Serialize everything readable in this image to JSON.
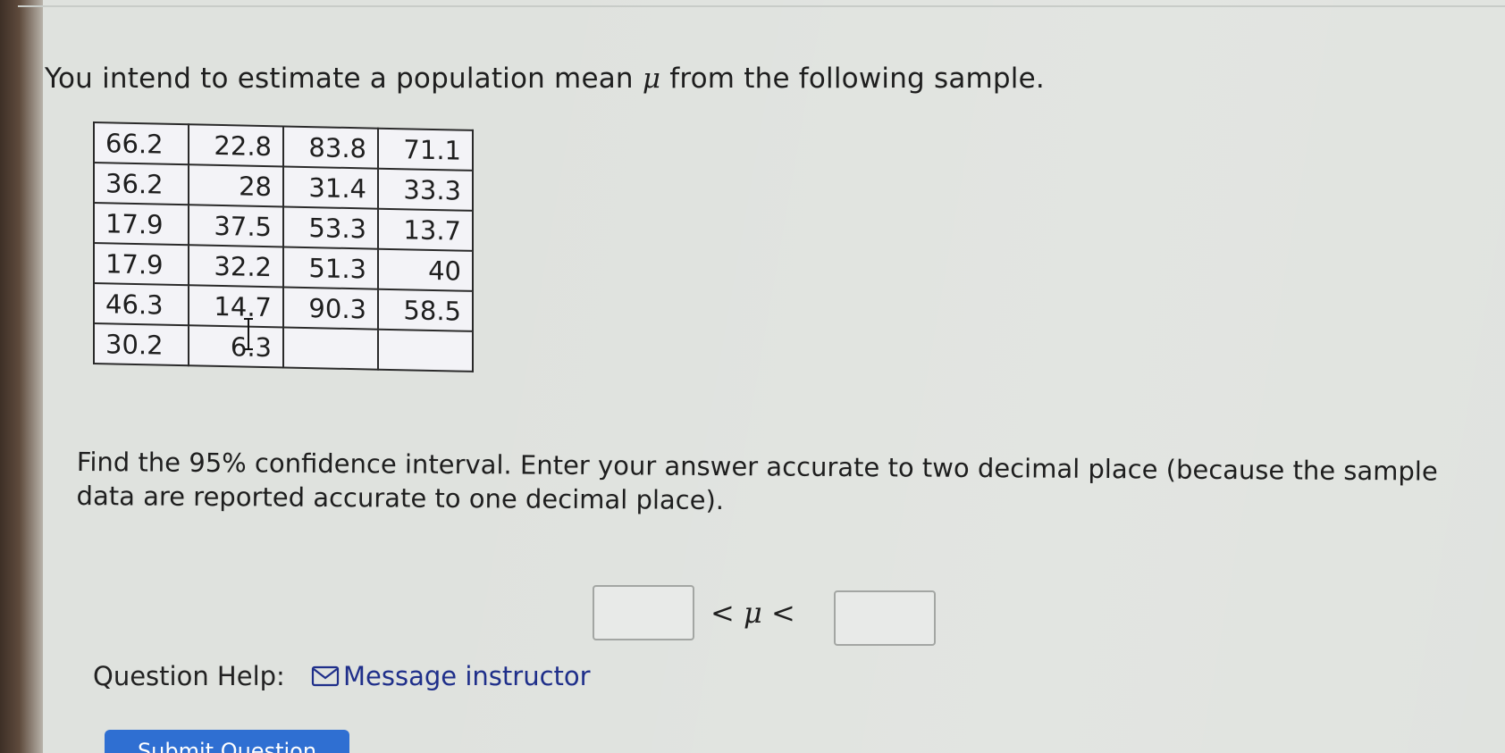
{
  "question": {
    "intro_before_mu": "You intend to estimate a population mean ",
    "mu_symbol": "μ",
    "intro_after_mu": " from the following sample."
  },
  "sample_table": {
    "rows": [
      [
        "66.2",
        "22.8",
        "83.8",
        "71.1"
      ],
      [
        "36.2",
        "28",
        "31.4",
        "33.3"
      ],
      [
        "17.9",
        "37.5",
        "53.3",
        "13.7"
      ],
      [
        "17.9",
        "32.2",
        "51.3",
        "40"
      ],
      [
        "46.3",
        "14.7",
        "90.3",
        "58.5"
      ],
      [
        "30.2",
        "6.3",
        "",
        ""
      ]
    ]
  },
  "prompt": {
    "text": "Find the 95% confidence interval. Enter your answer accurate to two decimal place (because the sample data are reported accurate to one decimal place)."
  },
  "answer": {
    "lower_value": "",
    "upper_value": "",
    "inequality": "< μ <"
  },
  "help": {
    "label": "Question Help:",
    "message_link": "Message instructor",
    "mail_icon": "envelope-icon"
  },
  "submit": {
    "label": "Submit Question",
    "color": "#2f6fd2"
  },
  "cursor": {
    "icon": "text-cursor-icon"
  }
}
